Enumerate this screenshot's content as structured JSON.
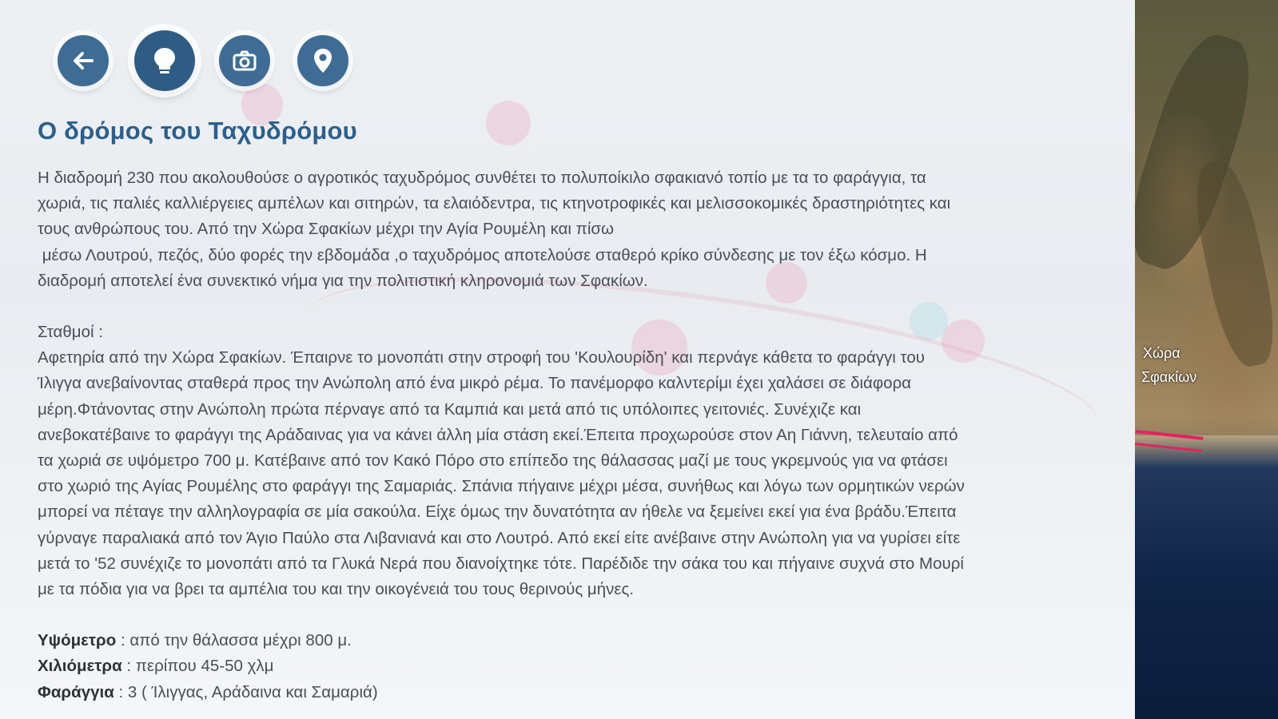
{
  "toolbar": {
    "buttons": [
      {
        "name": "back",
        "icon": "arrow-left-icon"
      },
      {
        "name": "info",
        "icon": "lightbulb-icon"
      },
      {
        "name": "photos",
        "icon": "camera-icon"
      },
      {
        "name": "location",
        "icon": "map-pin-icon"
      }
    ]
  },
  "article": {
    "title": "Ο δρόμος του Ταχυδρόμου",
    "intro": [
      "Η διαδρομή 230 που ακολουθούσε ο αγροτικός ταχυδρόμος συνθέτει το πολυποίκιλο σφακιανό τοπίο με τα το φαράγγια, τα",
      "χωριά, τις παλιές καλλιέργειες αμπέλων και σιτηρών, τα ελαιόδεντρα, τις κτηνοτροφικές και μελισσοκομικές δραστηριότητες και",
      "τους ανθρώπους του. Από την Χώρα Σφακίων μέχρι την Αγία Ρουμέλη και πίσω",
      " μέσω Λουτρού, πεζός, δύο φορές την εβδομάδα ,ο ταχυδρόμος αποτελούσε σταθερό κρίκο σύνδεσης με τον έξω κόσμο. Η",
      "διαδρομή αποτελεί ένα συνεκτικό νήμα για την πολιτιστική κληρονομιά των Σφακίων."
    ],
    "stations_heading": "Σταθμοί :",
    "stations": [
      "Αφετηρία από την Χώρα Σφακίων. Έπαιρνε το μονοπάτι στην στροφή του 'Κουλουρίδη' και περνάγε κάθετα το φαράγγι του",
      "Ίλιγγα ανεβαίνοντας σταθερά προς την Ανώπολη από ένα μικρό ρέμα. Το πανέμορφο καλντερίμι έχει χαλάσει σε διάφορα",
      "μέρη.Φτάνοντας στην Ανώπολη πρώτα πέρναγε από τα Καμπιά και μετά από τις υπόλοιπες γειτονιές. Συνέχιζε και",
      "ανεβοκατέβαινε το φαράγγι της Αράδαινας για να κάνει άλλη μία στάση εκεί.Έπειτα προχωρούσε στον Αη Γιάννη, τελευταίο από",
      "τα χωριά σε υψόμετρο 700 μ. Κατέβαινε από τον Κακό Πόρο στο επίπεδο της θάλασσας μαζί με τους γκρεμνούς για να φτάσει",
      "στο χωριό της Αγίας Ρουμέλης στο φαράγγι της Σαμαριάς. Σπάνια πήγαινε μέχρι μέσα, συνήθως και λόγω των ορμητικών νερών",
      "μπορεί να πέταγε την αλληλογραφία σε μία σακούλα. Είχε όμως την δυνατότητα αν ήθελε να ξεμείνει εκεί για ένα βράδυ.Έπειτα",
      "γύρναγε παραλιακά από τον Άγιο Παύλο στα Λιβανιανά και στο Λουτρό. Από εκεί είτε ανέβαινε στην Ανώπολη για να γυρίσει είτε",
      "μετά το '52 συνέχιζε το μονοπάτι από τα Γλυκά Νερά που διανοίχτηκε τότε. Παρέδιδε την σάκα του και πήγαινε συχνά στο Μουρί",
      "με τα πόδια για να βρει τα αμπέλια του και την οικογένειά του τους θερινούς μήνες."
    ],
    "facts": [
      {
        "label": "Υψόμετρο",
        "value": " : από την θάλασσα μέχρι 800 μ."
      },
      {
        "label": "Χιλιόμετρα",
        "value": " : περίπου 45-50 χλμ"
      },
      {
        "label": "Φαράγγια",
        "value": " : 3 ( Ίλιγγας, Αράδαινα και Σαμαριά)"
      }
    ]
  },
  "map": {
    "labels": [
      "Χώρα",
      "Σφακίων"
    ],
    "route_color": "#e3245f"
  },
  "colors": {
    "accent": "#3e6c95",
    "title": "#2b5f8d"
  }
}
